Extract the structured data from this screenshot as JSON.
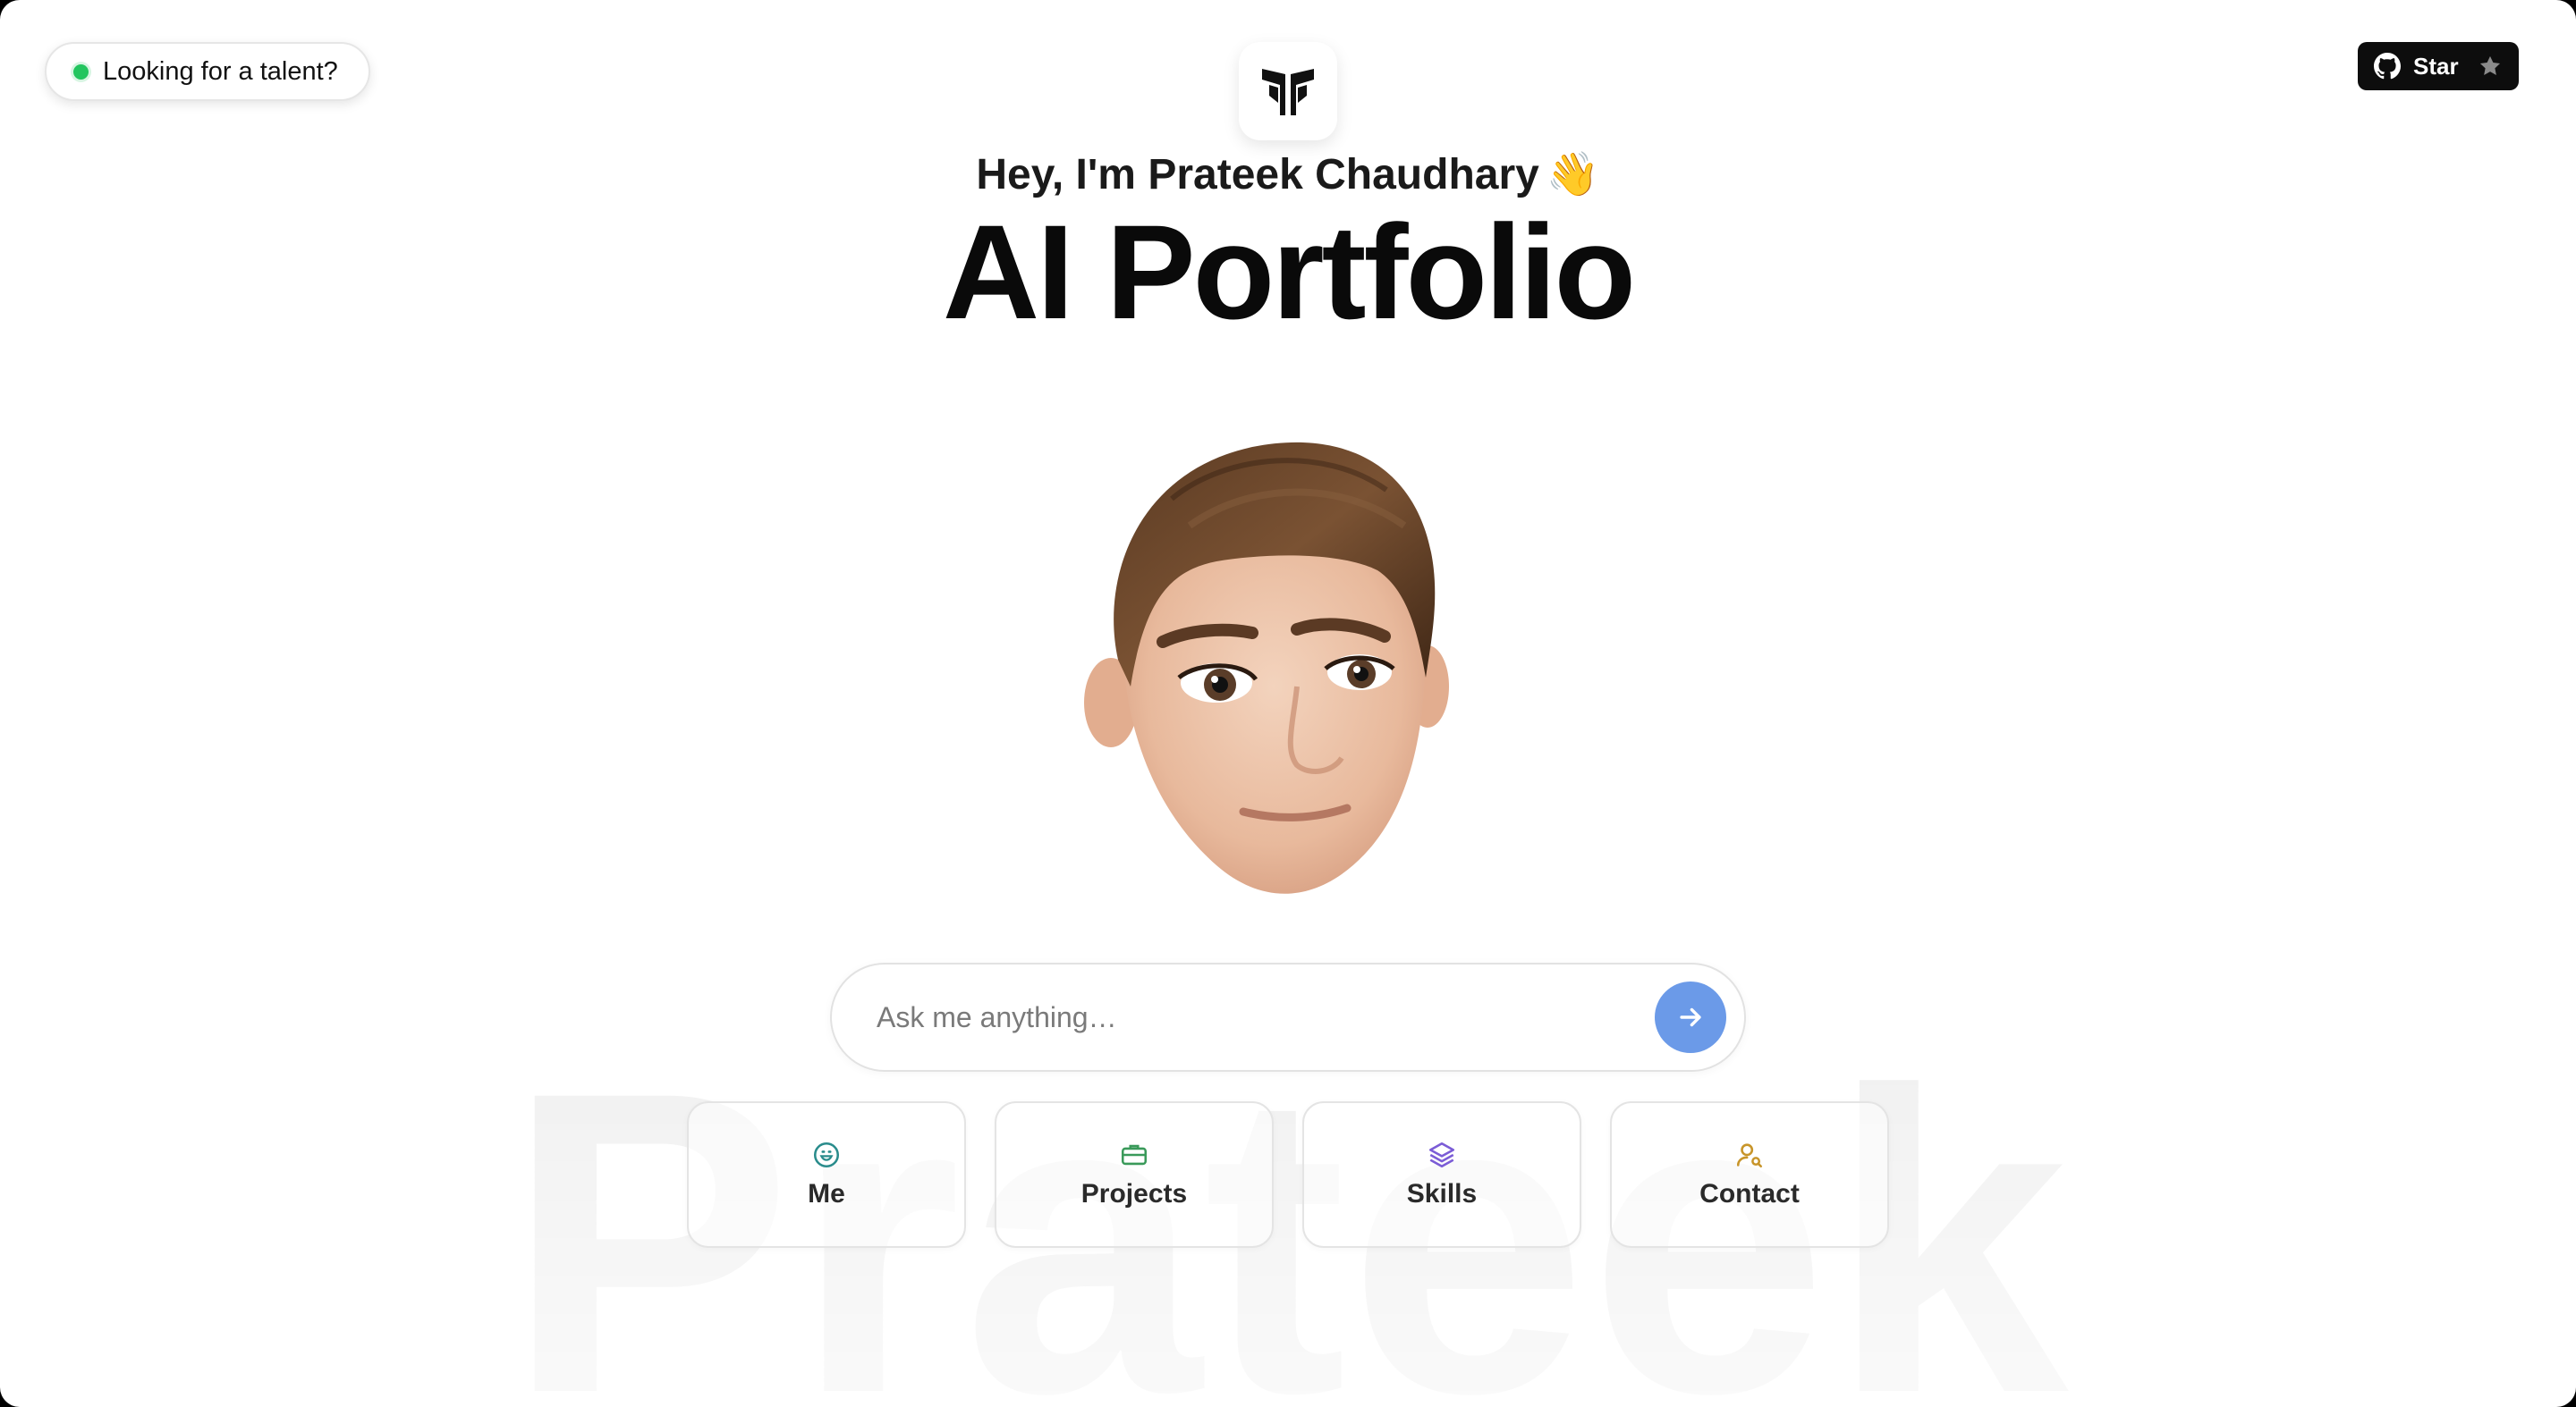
{
  "talent_pill": {
    "label": "Looking for a talent?",
    "status_color": "#22c55e"
  },
  "github": {
    "star_label": "Star",
    "button_color": "#0d0d0d",
    "icon": "github-icon"
  },
  "hero": {
    "greeting": "Hey, I'm Prateek Chaudhary",
    "wave": "👋",
    "title": "AI Portfolio"
  },
  "watermark": "Prateek",
  "ask": {
    "placeholder": "Ask me anything…",
    "send_color": "#6b9ae8"
  },
  "cards": [
    {
      "label": "Me",
      "icon": "smile-icon",
      "color": "#2a8c8c"
    },
    {
      "label": "Projects",
      "icon": "briefcase-icon",
      "color": "#3a9a5a"
    },
    {
      "label": "Skills",
      "icon": "layers-icon",
      "color": "#7b5cd6"
    },
    {
      "label": "Contact",
      "icon": "user-search-icon",
      "color": "#c8952a"
    }
  ]
}
